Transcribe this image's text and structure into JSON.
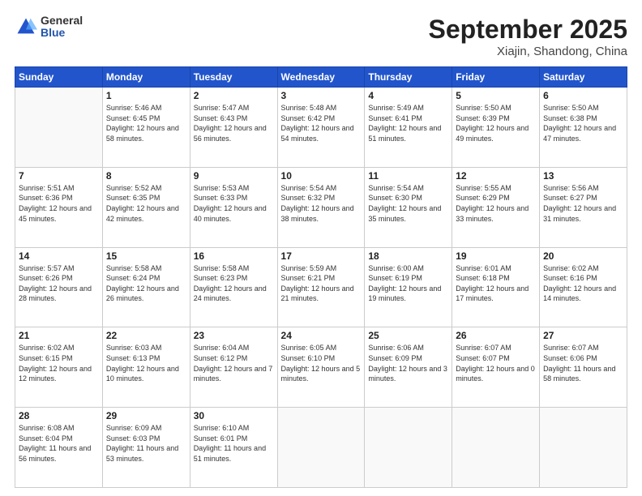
{
  "logo": {
    "general": "General",
    "blue": "Blue"
  },
  "header": {
    "title": "September 2025",
    "subtitle": "Xiajin, Shandong, China"
  },
  "calendar": {
    "days_of_week": [
      "Sunday",
      "Monday",
      "Tuesday",
      "Wednesday",
      "Thursday",
      "Friday",
      "Saturday"
    ],
    "weeks": [
      [
        {
          "day": "",
          "sunrise": "",
          "sunset": "",
          "daylight": "",
          "empty": true
        },
        {
          "day": "1",
          "sunrise": "Sunrise: 5:46 AM",
          "sunset": "Sunset: 6:45 PM",
          "daylight": "Daylight: 12 hours and 58 minutes."
        },
        {
          "day": "2",
          "sunrise": "Sunrise: 5:47 AM",
          "sunset": "Sunset: 6:43 PM",
          "daylight": "Daylight: 12 hours and 56 minutes."
        },
        {
          "day": "3",
          "sunrise": "Sunrise: 5:48 AM",
          "sunset": "Sunset: 6:42 PM",
          "daylight": "Daylight: 12 hours and 54 minutes."
        },
        {
          "day": "4",
          "sunrise": "Sunrise: 5:49 AM",
          "sunset": "Sunset: 6:41 PM",
          "daylight": "Daylight: 12 hours and 51 minutes."
        },
        {
          "day": "5",
          "sunrise": "Sunrise: 5:50 AM",
          "sunset": "Sunset: 6:39 PM",
          "daylight": "Daylight: 12 hours and 49 minutes."
        },
        {
          "day": "6",
          "sunrise": "Sunrise: 5:50 AM",
          "sunset": "Sunset: 6:38 PM",
          "daylight": "Daylight: 12 hours and 47 minutes."
        }
      ],
      [
        {
          "day": "7",
          "sunrise": "Sunrise: 5:51 AM",
          "sunset": "Sunset: 6:36 PM",
          "daylight": "Daylight: 12 hours and 45 minutes."
        },
        {
          "day": "8",
          "sunrise": "Sunrise: 5:52 AM",
          "sunset": "Sunset: 6:35 PM",
          "daylight": "Daylight: 12 hours and 42 minutes."
        },
        {
          "day": "9",
          "sunrise": "Sunrise: 5:53 AM",
          "sunset": "Sunset: 6:33 PM",
          "daylight": "Daylight: 12 hours and 40 minutes."
        },
        {
          "day": "10",
          "sunrise": "Sunrise: 5:54 AM",
          "sunset": "Sunset: 6:32 PM",
          "daylight": "Daylight: 12 hours and 38 minutes."
        },
        {
          "day": "11",
          "sunrise": "Sunrise: 5:54 AM",
          "sunset": "Sunset: 6:30 PM",
          "daylight": "Daylight: 12 hours and 35 minutes."
        },
        {
          "day": "12",
          "sunrise": "Sunrise: 5:55 AM",
          "sunset": "Sunset: 6:29 PM",
          "daylight": "Daylight: 12 hours and 33 minutes."
        },
        {
          "day": "13",
          "sunrise": "Sunrise: 5:56 AM",
          "sunset": "Sunset: 6:27 PM",
          "daylight": "Daylight: 12 hours and 31 minutes."
        }
      ],
      [
        {
          "day": "14",
          "sunrise": "Sunrise: 5:57 AM",
          "sunset": "Sunset: 6:26 PM",
          "daylight": "Daylight: 12 hours and 28 minutes."
        },
        {
          "day": "15",
          "sunrise": "Sunrise: 5:58 AM",
          "sunset": "Sunset: 6:24 PM",
          "daylight": "Daylight: 12 hours and 26 minutes."
        },
        {
          "day": "16",
          "sunrise": "Sunrise: 5:58 AM",
          "sunset": "Sunset: 6:23 PM",
          "daylight": "Daylight: 12 hours and 24 minutes."
        },
        {
          "day": "17",
          "sunrise": "Sunrise: 5:59 AM",
          "sunset": "Sunset: 6:21 PM",
          "daylight": "Daylight: 12 hours and 21 minutes."
        },
        {
          "day": "18",
          "sunrise": "Sunrise: 6:00 AM",
          "sunset": "Sunset: 6:19 PM",
          "daylight": "Daylight: 12 hours and 19 minutes."
        },
        {
          "day": "19",
          "sunrise": "Sunrise: 6:01 AM",
          "sunset": "Sunset: 6:18 PM",
          "daylight": "Daylight: 12 hours and 17 minutes."
        },
        {
          "day": "20",
          "sunrise": "Sunrise: 6:02 AM",
          "sunset": "Sunset: 6:16 PM",
          "daylight": "Daylight: 12 hours and 14 minutes."
        }
      ],
      [
        {
          "day": "21",
          "sunrise": "Sunrise: 6:02 AM",
          "sunset": "Sunset: 6:15 PM",
          "daylight": "Daylight: 12 hours and 12 minutes."
        },
        {
          "day": "22",
          "sunrise": "Sunrise: 6:03 AM",
          "sunset": "Sunset: 6:13 PM",
          "daylight": "Daylight: 12 hours and 10 minutes."
        },
        {
          "day": "23",
          "sunrise": "Sunrise: 6:04 AM",
          "sunset": "Sunset: 6:12 PM",
          "daylight": "Daylight: 12 hours and 7 minutes."
        },
        {
          "day": "24",
          "sunrise": "Sunrise: 6:05 AM",
          "sunset": "Sunset: 6:10 PM",
          "daylight": "Daylight: 12 hours and 5 minutes."
        },
        {
          "day": "25",
          "sunrise": "Sunrise: 6:06 AM",
          "sunset": "Sunset: 6:09 PM",
          "daylight": "Daylight: 12 hours and 3 minutes."
        },
        {
          "day": "26",
          "sunrise": "Sunrise: 6:07 AM",
          "sunset": "Sunset: 6:07 PM",
          "daylight": "Daylight: 12 hours and 0 minutes."
        },
        {
          "day": "27",
          "sunrise": "Sunrise: 6:07 AM",
          "sunset": "Sunset: 6:06 PM",
          "daylight": "Daylight: 11 hours and 58 minutes."
        }
      ],
      [
        {
          "day": "28",
          "sunrise": "Sunrise: 6:08 AM",
          "sunset": "Sunset: 6:04 PM",
          "daylight": "Daylight: 11 hours and 56 minutes."
        },
        {
          "day": "29",
          "sunrise": "Sunrise: 6:09 AM",
          "sunset": "Sunset: 6:03 PM",
          "daylight": "Daylight: 11 hours and 53 minutes."
        },
        {
          "day": "30",
          "sunrise": "Sunrise: 6:10 AM",
          "sunset": "Sunset: 6:01 PM",
          "daylight": "Daylight: 11 hours and 51 minutes."
        },
        {
          "day": "",
          "sunrise": "",
          "sunset": "",
          "daylight": "",
          "empty": true
        },
        {
          "day": "",
          "sunrise": "",
          "sunset": "",
          "daylight": "",
          "empty": true
        },
        {
          "day": "",
          "sunrise": "",
          "sunset": "",
          "daylight": "",
          "empty": true
        },
        {
          "day": "",
          "sunrise": "",
          "sunset": "",
          "daylight": "",
          "empty": true
        }
      ]
    ]
  }
}
